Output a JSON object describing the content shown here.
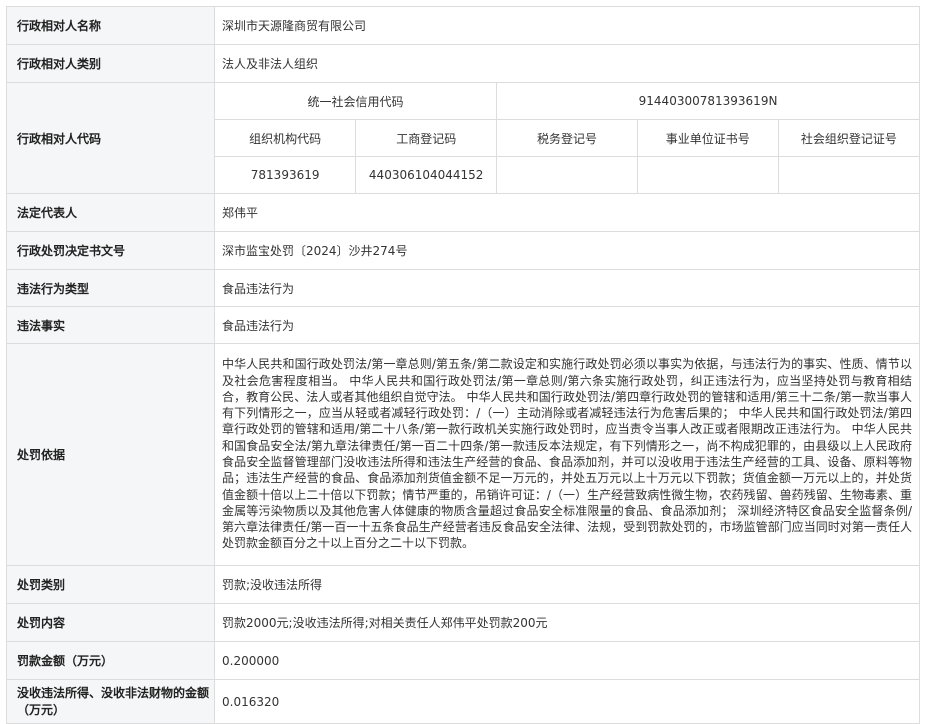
{
  "rows": {
    "name": {
      "label": "行政相对人名称",
      "value": "深圳市天源隆商贸有限公司"
    },
    "category": {
      "label": "行政相对人类别",
      "value": "法人及非法人组织"
    },
    "code": {
      "label": "行政相对人代码",
      "uscc_label": "统一社会信用代码",
      "uscc_value": "91440300781393619N",
      "headers": [
        "组织机构代码",
        "工商登记码",
        "税务登记号",
        "事业单位证书号",
        "社会组织登记证号"
      ],
      "values": [
        "781393619",
        "440306104044152",
        "",
        "",
        ""
      ]
    },
    "legal_rep": {
      "label": "法定代表人",
      "value": "郑伟平"
    },
    "doc_no": {
      "label": "行政处罚决定书文号",
      "value": "深市监宝处罚〔2024〕沙井274号"
    },
    "violation_type": {
      "label": "违法行为类型",
      "value": "食品违法行为"
    },
    "violation_fact": {
      "label": "违法事实",
      "value": "食品违法行为"
    },
    "basis": {
      "label": "处罚依据",
      "value": "中华人民共和国行政处罚法/第一章总则/第五条/第二款设定和实施行政处罚必须以事实为依据，与违法行为的事实、性质、情节以及社会危害程度相当。 中华人民共和国行政处罚法/第一章总则/第六条实施行政处罚，纠正违法行为，应当坚持处罚与教育相结合，教育公民、法人或者其他组织自觉守法。 中华人民共和国行政处罚法/第四章行政处罚的管辖和适用/第三十二条/第一款当事人有下列情形之一，应当从轻或者减轻行政处罚：/（一）主动消除或者减轻违法行为危害后果的； 中华人民共和国行政处罚法/第四章行政处罚的管辖和适用/第二十八条/第一款行政机关实施行政处罚时，应当责令当事人改正或者限期改正违法行为。 中华人民共和国食品安全法/第九章法律责任/第一百二十四条/第一款违反本法规定，有下列情形之一，尚不构成犯罪的，由县级以上人民政府食品安全监督管理部门没收违法所得和违法生产经营的食品、食品添加剂，并可以没收用于违法生产经营的工具、设备、原料等物品；违法生产经营的食品、食品添加剂货值金额不足一万元的，并处五万元以上十万元以下罚款；货值金额一万元以上的，并处货值金额十倍以上二十倍以下罚款；情节严重的，吊销许可证：/（一）生产经营致病性微生物，农药残留、兽药残留、生物毒素、重金属等污染物质以及其他危害人体健康的物质含量超过食品安全标准限量的食品、食品添加剂； 深圳经济特区食品安全监督条例/第六章法律责任/第一百一十五条食品生产经营者违反食品安全法律、法规，受到罚款处罚的，市场监管部门应当同时对第一责任人处罚款金额百分之十以上百分之二十以下罚款。"
    },
    "penalty_type": {
      "label": "处罚类别",
      "value": "罚款;没收违法所得"
    },
    "penalty_content": {
      "label": "处罚内容",
      "value": "罚款2000元;没收违法所得;对相关责任人郑伟平处罚款200元"
    },
    "fine": {
      "label": "罚款金额（万元）",
      "value": "0.200000"
    },
    "confiscation": {
      "label": "没收违法所得、没收非法财物的金额（万元）",
      "value": "0.016320"
    }
  }
}
